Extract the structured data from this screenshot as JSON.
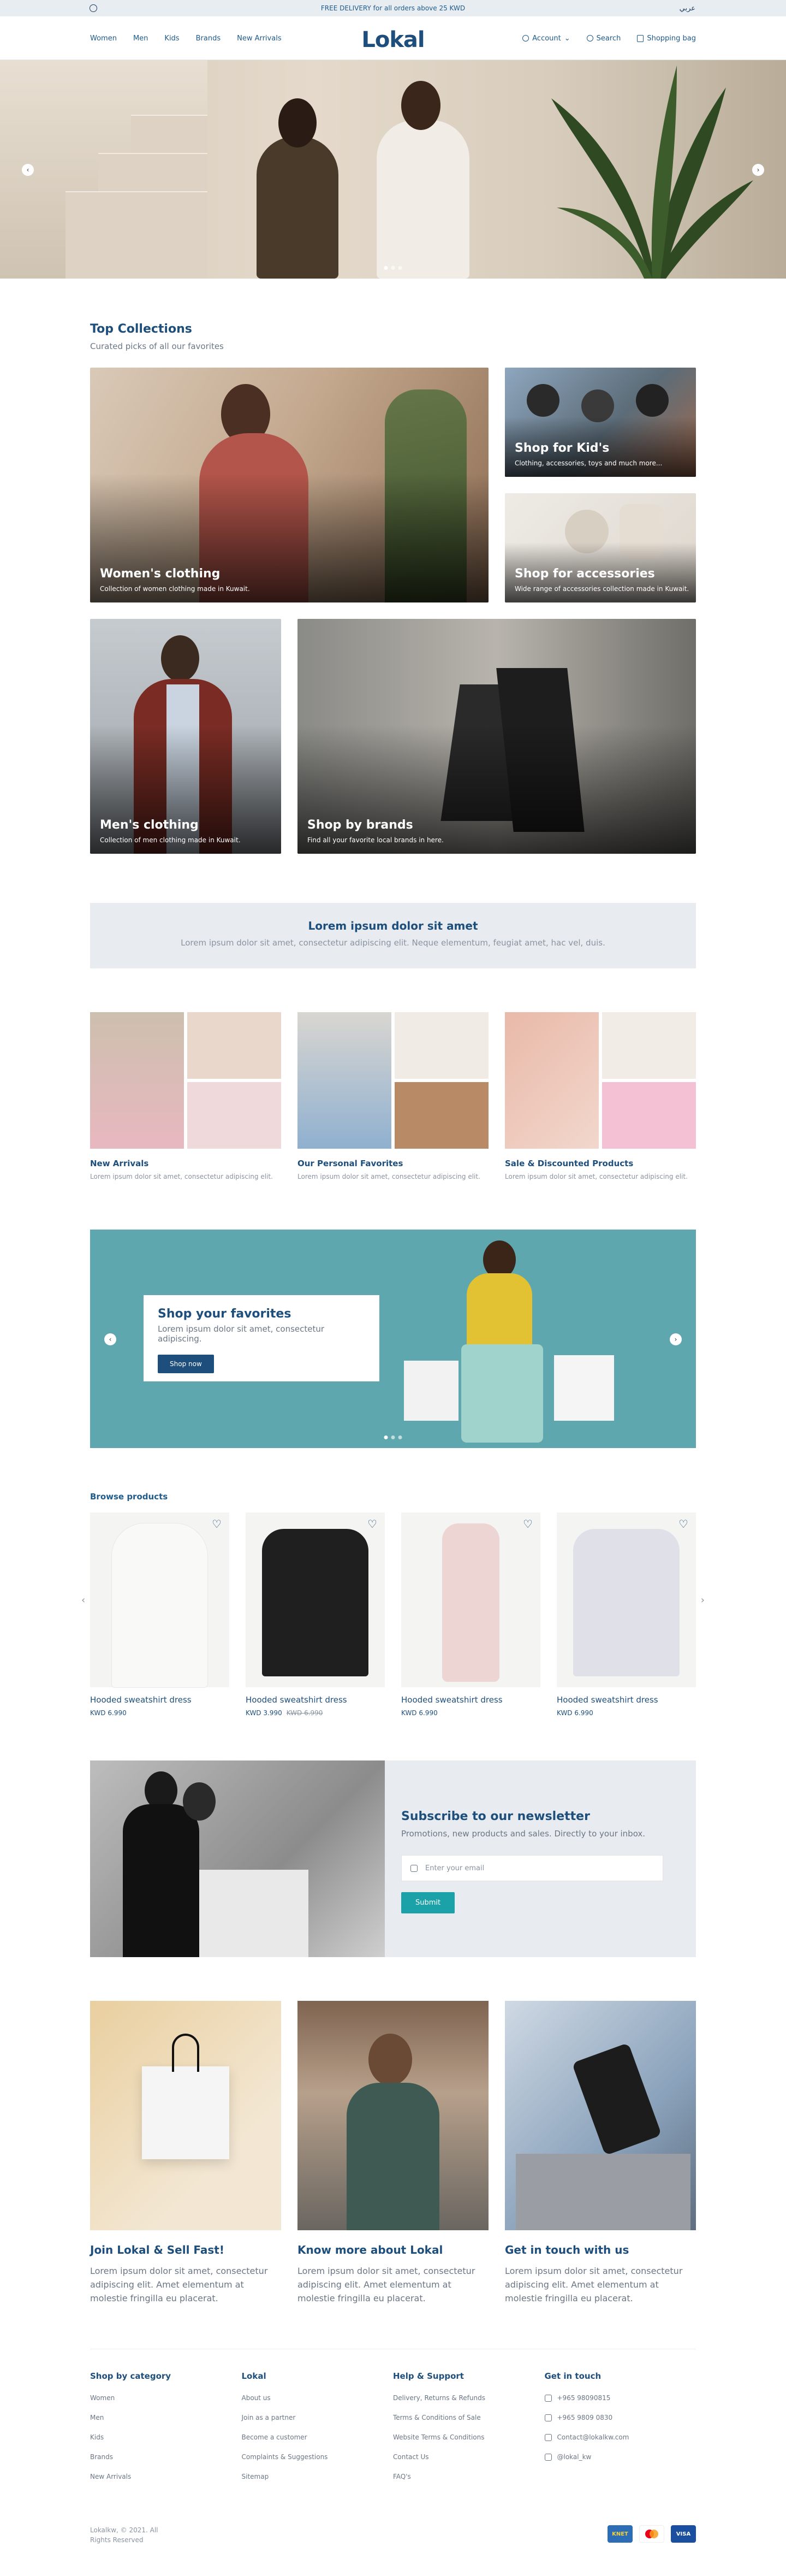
{
  "topbar": {
    "promo": "FREE DELIVERY for all orders above 25 KWD",
    "language": "عربي"
  },
  "header": {
    "nav": [
      "Women",
      "Men",
      "Kids",
      "Brands",
      "New Arrivals"
    ],
    "logo": "Lokal",
    "account": "Account",
    "search": "Search",
    "bag": "Shopping bag"
  },
  "collections": {
    "title": "Top Collections",
    "subtitle": "Curated picks of all our favorites",
    "cards": [
      {
        "title": "Women's clothing",
        "desc": "Collection of women clothing made in Kuwait."
      },
      {
        "title": "Shop for Kid's",
        "desc": "Clothing, accessories, toys and much more..."
      },
      {
        "title": "Shop for accessories",
        "desc": "Wide range of accessories collection made in Kuwait."
      },
      {
        "title": "Men's clothing",
        "desc": "Collection of men clothing made in Kuwait."
      },
      {
        "title": "Shop by brands",
        "desc": "Find all your favorite local brands in here."
      }
    ]
  },
  "promo": {
    "title": "Lorem ipsum dolor sit amet",
    "text": "Lorem ipsum dolor sit amet, consectetur adipiscing elit. Neque elementum, feugiat amet, hac vel, duis."
  },
  "tiles": [
    {
      "title": "New Arrivals",
      "text": "Lorem ipsum dolor sit amet, consectetur adipiscing elit."
    },
    {
      "title": "Our Personal Favorites",
      "text": "Lorem ipsum dolor sit amet, consectetur adipiscing elit."
    },
    {
      "title": "Sale & Discounted Products",
      "text": "Lorem ipsum dolor sit amet, consectetur adipiscing elit."
    }
  ],
  "slider": {
    "title": "Shop your favorites",
    "text": "Lorem ipsum dolor sit amet, consectetur adipiscing.",
    "button": "Shop now"
  },
  "browse": {
    "title": "Browse products",
    "products": [
      {
        "name": "Hooded sweatshirt dress",
        "price": "KWD 6.990",
        "old": ""
      },
      {
        "name": "Hooded sweatshirt dress",
        "price": "KWD 3.990",
        "old": "KWD 6.990"
      },
      {
        "name": "Hooded sweatshirt dress",
        "price": "KWD 6.990",
        "old": ""
      },
      {
        "name": "Hooded sweatshirt dress",
        "price": "KWD 6.990",
        "old": ""
      }
    ]
  },
  "newsletter": {
    "title": "Subscribe to our newsletter",
    "text": "Promotions, new products and sales. Directly to your inbox.",
    "placeholder": "Enter your email",
    "button": "Submit"
  },
  "infos": [
    {
      "title": "Join Lokal & Sell Fast!",
      "text": "Lorem ipsum dolor sit amet, consectetur adipiscing elit. Amet elementum at molestie fringilla eu placerat."
    },
    {
      "title": "Know more about Lokal",
      "text": "Lorem ipsum dolor sit amet, consectetur adipiscing elit. Amet elementum at molestie fringilla eu placerat."
    },
    {
      "title": "Get in touch with us",
      "text": "Lorem ipsum dolor sit amet, consectetur adipiscing elit. Amet elementum at molestie fringilla eu placerat."
    }
  ],
  "footer": {
    "cols": [
      {
        "title": "Shop by category",
        "links": [
          "Women",
          "Men",
          "Kids",
          "Brands",
          "New Arrivals"
        ]
      },
      {
        "title": "Lokal",
        "links": [
          "About us",
          "Join as a partner",
          "Become a customer",
          "Complaints & Suggestions",
          "Sitemap"
        ]
      },
      {
        "title": "Help & Support",
        "links": [
          "Delivery, Returns & Refunds",
          "Terms & Conditions of Sale",
          "Website Terms & Conditions",
          "Contact Us",
          "FAQ's"
        ]
      },
      {
        "title": "Get in touch",
        "links": [
          "+965 98090815",
          "+965 9809 0830",
          "Contact@lokalkw.com",
          "@lokal_kw"
        ]
      }
    ],
    "copyright": "Lokalkw, © 2021. All Rights Reserved",
    "payments": [
      "KNET",
      "Mastercard",
      "VISA"
    ]
  },
  "colors": {
    "brand": "#1e4f7c",
    "teal": "#5fa7ae",
    "submit": "#1ba2a8",
    "panel": "#e8ecf0"
  }
}
